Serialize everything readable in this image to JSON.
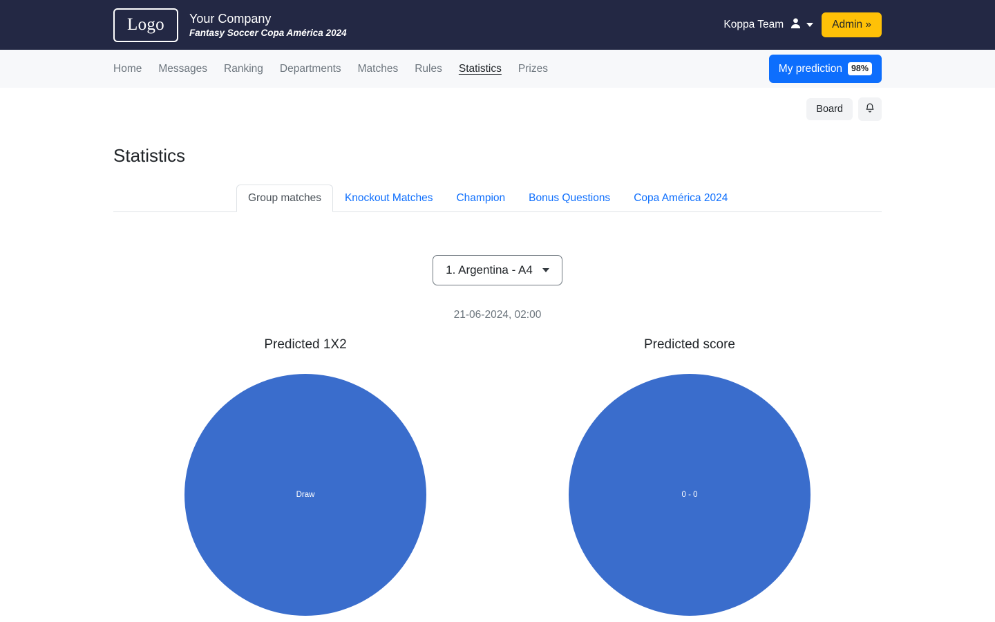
{
  "header": {
    "logo_text": "Logo",
    "company": "Your Company",
    "tagline": "Fantasy Soccer Copa América 2024",
    "user_name": "Koppa Team",
    "admin_label": "Admin »"
  },
  "nav": {
    "items": [
      {
        "label": "Home",
        "active": false
      },
      {
        "label": "Messages",
        "active": false
      },
      {
        "label": "Ranking",
        "active": false
      },
      {
        "label": "Departments",
        "active": false
      },
      {
        "label": "Matches",
        "active": false
      },
      {
        "label": "Rules",
        "active": false
      },
      {
        "label": "Statistics",
        "active": true
      },
      {
        "label": "Prizes",
        "active": false
      }
    ],
    "prediction_label": "My prediction",
    "prediction_percent": "98%"
  },
  "toolbar": {
    "board_label": "Board",
    "bell_icon": "bell-icon"
  },
  "page": {
    "title": "Statistics"
  },
  "tabs": [
    {
      "label": "Group matches",
      "active": true
    },
    {
      "label": "Knockout Matches",
      "active": false
    },
    {
      "label": "Champion",
      "active": false
    },
    {
      "label": "Bonus Questions",
      "active": false
    },
    {
      "label": "Copa América 2024",
      "active": false
    }
  ],
  "selector": {
    "selected": "1. Argentina - A4"
  },
  "match": {
    "datetime": "21-06-2024, 02:00"
  },
  "colors": {
    "navy": "#232844",
    "accent_blue": "#0d6efd",
    "pie_blue": "#3a6dcc",
    "admin_yellow": "#ffc107"
  },
  "chart_data": [
    {
      "type": "pie",
      "title": "Predicted 1X2",
      "categories": [
        "Draw"
      ],
      "values": [
        100
      ],
      "labels": [
        "Draw"
      ],
      "colors": [
        "#3a6dcc"
      ],
      "legend": false,
      "units": "percent"
    },
    {
      "type": "pie",
      "title": "Predicted score",
      "categories": [
        "0 - 0"
      ],
      "values": [
        100
      ],
      "labels": [
        "0 - 0"
      ],
      "colors": [
        "#3a6dcc"
      ],
      "legend": false,
      "units": "percent"
    }
  ]
}
